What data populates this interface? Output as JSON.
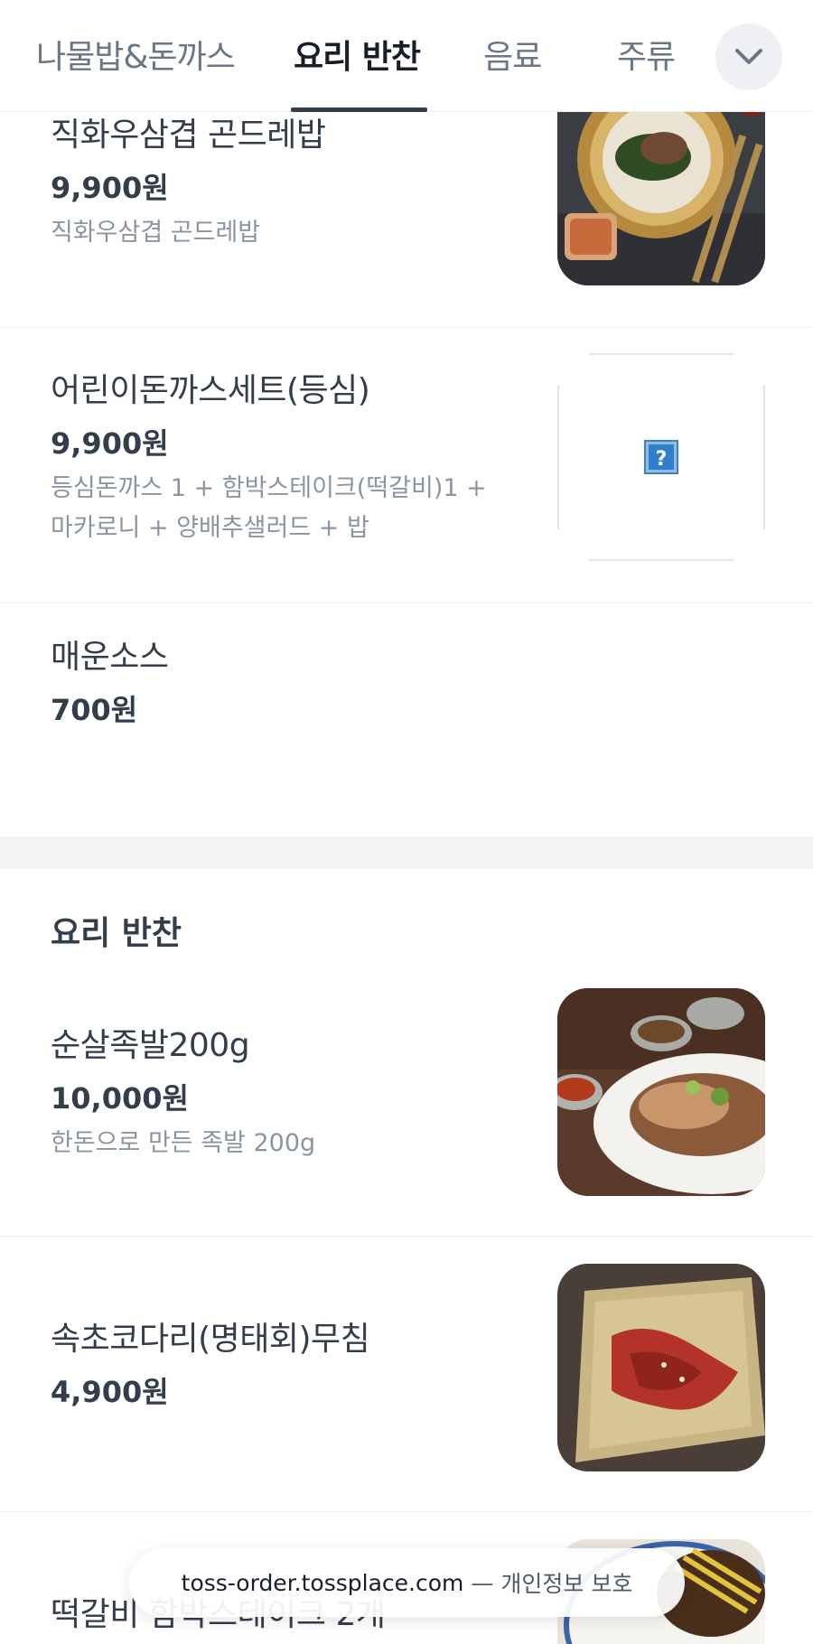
{
  "tabs": [
    {
      "label": "나물밥&돈까스",
      "active": false
    },
    {
      "label": "요리 반찬",
      "active": true
    },
    {
      "label": "음료",
      "active": false
    },
    {
      "label": "주류",
      "active": false
    }
  ],
  "tab_more_icon": "chevron-down-icon",
  "items": [
    {
      "name": "직화우삼겹 곤드레밥",
      "price": "9,900원",
      "desc": "직화우삼겹 곤드레밥",
      "image": "bibimbap-photo"
    },
    {
      "name": "어린이돈까스세트(등심)",
      "price": "9,900원",
      "desc": "등심돈까스 1 + 함박스테이크(떡갈비)1 + 마카로니 + 양배추샐러드 + 밥",
      "image": "broken-image-icon"
    },
    {
      "name": "매운소스",
      "price": "700원"
    }
  ],
  "section": {
    "title": "요리 반찬",
    "items": [
      {
        "name": "순살족발200g",
        "price": "10,000원",
        "desc": "한돈으로 만든 족발 200g",
        "image": "jokbal-photo"
      },
      {
        "name": "속초코다리(명태회)무침",
        "price": "4,900원",
        "image": "muchim-photo"
      },
      {
        "name": "떡갈비 함박스테이크 2개",
        "image": "tteokgalbi-photo"
      }
    ]
  },
  "toast": {
    "domain": "toss-order.tossplace.com",
    "separator": "—",
    "note": "개인정보 보호"
  },
  "colors": {
    "text_primary": "#333d4b",
    "text_secondary": "#8b95a1",
    "divider": "#eceef1",
    "section_bg": "#f2f4f6"
  }
}
